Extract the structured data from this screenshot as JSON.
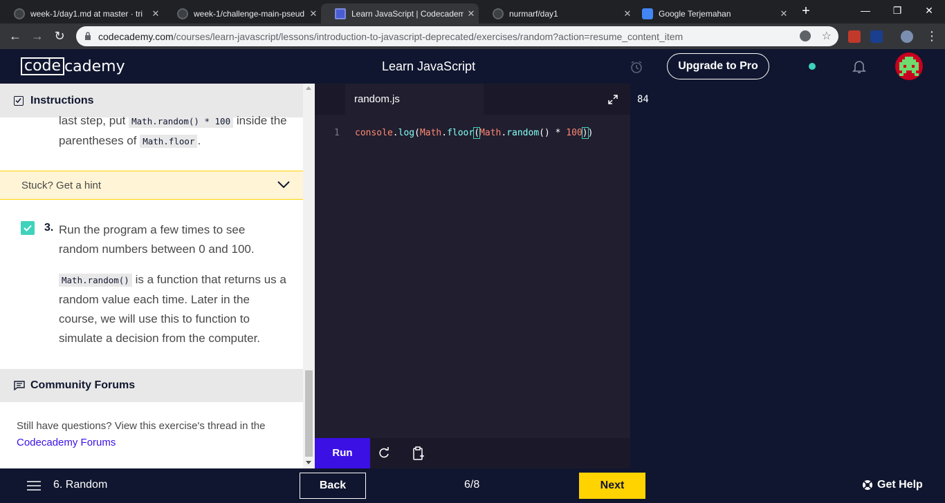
{
  "browser": {
    "tabs": [
      {
        "title": "week-1/day1.md at master · tri",
        "icon": "github-icon"
      },
      {
        "title": "week-1/challenge-main-pseud",
        "icon": "github-icon"
      },
      {
        "title": "Learn JavaScript | Codecademy",
        "icon": "codecademy-icon"
      },
      {
        "title": "nurmarf/day1",
        "icon": "github-icon"
      },
      {
        "title": "Google Terjemahan",
        "icon": "google-translate-icon"
      }
    ],
    "url_host": "codecademy.com",
    "url_path": "/courses/learn-javascript/lessons/introduction-to-javascript-deprecated/exercises/random?action=resume_content_item"
  },
  "header": {
    "logo_left": "code",
    "logo_right": "cademy",
    "course_title": "Learn JavaScript",
    "upgrade_label": "Upgrade to Pro"
  },
  "instructions": {
    "heading": "Instructions",
    "step2_text_a": "last step, put ",
    "step2_code_a": "Math.random() * 100",
    "step2_text_b": " inside the parentheses of ",
    "step2_code_b": "Math.floor",
    "step2_text_c": ".",
    "hint_label": "Stuck? Get a hint",
    "step3_number": "3.",
    "step3_text": "Run the program a few times to see random numbers between 0 and 100.",
    "step3_code": "Math.random()",
    "step3_detail": " is a function that returns us a random value each time. Later in the course, we will use this to function to simulate a decision from the computer."
  },
  "forums": {
    "heading": "Community Forums",
    "text": "Still have questions? View this exercise's thread in the ",
    "link": "Codecademy Forums"
  },
  "editor": {
    "filename": "random.js",
    "line_number": "1",
    "code": {
      "p1": "console",
      "p2": ".",
      "p3": "log",
      "p4": "(",
      "p5": "Math",
      "p6": ".",
      "p7": "floor",
      "p8": "(",
      "p9": "Math",
      "p10": ".",
      "p11": "random",
      "p12": "() * ",
      "p13": "100",
      "p14": ")",
      "p15": ")"
    },
    "run_label": "Run"
  },
  "output": {
    "text": "84"
  },
  "footer": {
    "lesson": "6. Random",
    "back_label": "Back",
    "progress": "6/8",
    "next_label": "Next",
    "help_label": "Get Help"
  },
  "colors": {
    "accent": "#3a10e5",
    "next": "#ffd300",
    "success": "#3fd3bc",
    "navy": "#10162f"
  }
}
